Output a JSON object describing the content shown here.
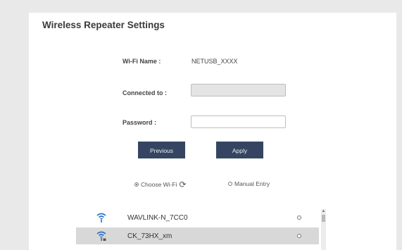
{
  "page": {
    "title": "Wireless Repeater Settings"
  },
  "form": {
    "wifi_name_label": "Wi-Fi Name :",
    "wifi_name_value": "NETUSB_XXXX",
    "connected_to_label": "Connected to :",
    "connected_to_value": "",
    "password_label": "Password :",
    "password_value": ""
  },
  "buttons": {
    "previous_label": "Previous",
    "apply_label": "Apply"
  },
  "mode": {
    "choose_wifi_label": "Choose Wi-Fi",
    "manual_entry_label": "Manual Entry",
    "selected": "choose_wifi"
  },
  "wifi_list": [
    {
      "ssid": "WAVLINK-N_7CC0",
      "selected": false,
      "icon": "wifi-signal-icon"
    },
    {
      "ssid": "CK_73HX_xm",
      "selected": true,
      "icon": "wifi-signal-icon"
    }
  ],
  "colors": {
    "button_bg": "#354561",
    "wifi_icon": "#2a72c8",
    "selected_row": "#d8d8d8"
  }
}
